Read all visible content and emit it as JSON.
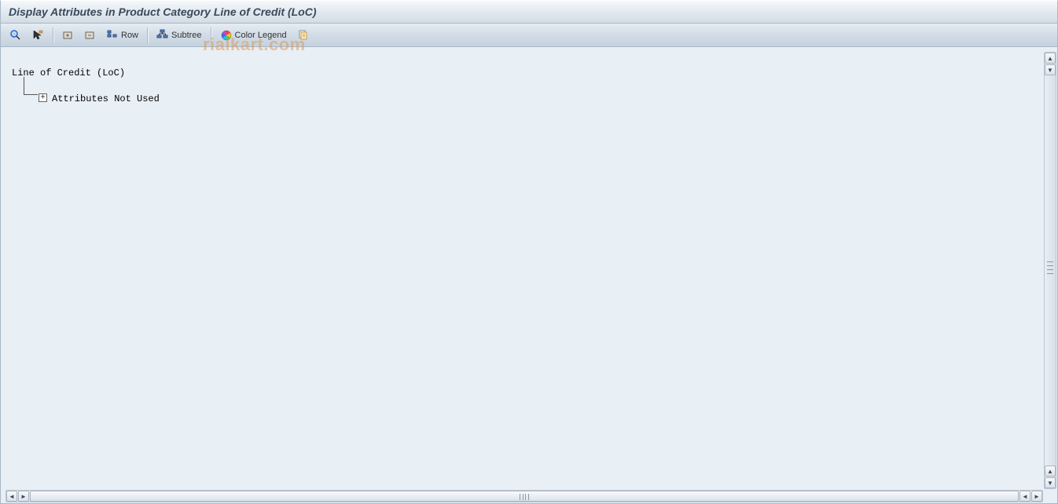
{
  "title": "Display Attributes in Product Category Line of Credit (LoC)",
  "toolbar": {
    "row_label": "Row",
    "subtree_label": "Subtree",
    "color_legend_label": "Color Legend"
  },
  "tree": {
    "root_label": "Line of Credit (LoC)",
    "child_label": "Attributes Not Used",
    "expand_symbol": "+"
  },
  "watermark": "rialkart.com"
}
